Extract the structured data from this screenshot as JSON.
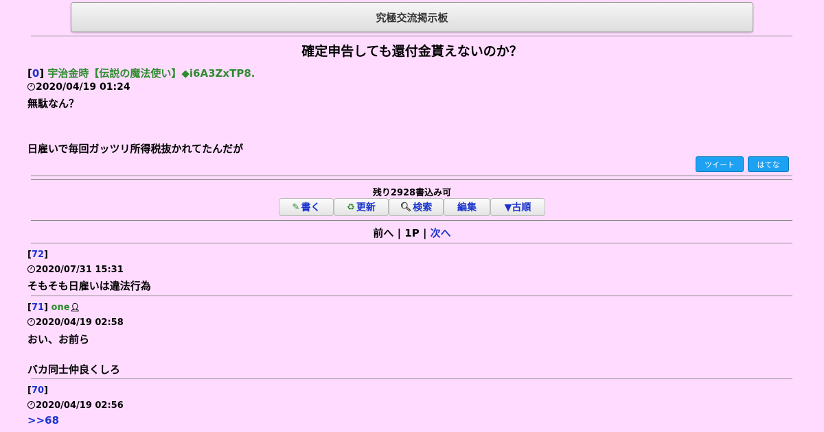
{
  "board": {
    "title": "究極交流掲示板"
  },
  "thread": {
    "title": "確定申告しても還付金貰えないのか？",
    "op": {
      "number": "0",
      "name": "宇治金時【伝説の魔法使い】◆i6A3ZxTP8.",
      "date": "2020/04/19 01:24",
      "lines": [
        "無駄なん？",
        "日雇いで毎回ガッツリ所得税抜かれてたんだが"
      ]
    }
  },
  "share": {
    "tweet_label": "ツイート",
    "hatena_label": "はてな"
  },
  "status": {
    "remaining": "残り2928書込み可"
  },
  "toolbar": {
    "write_label": "書く",
    "refresh_label": "更新",
    "search_label": "検索",
    "edit_label": "編集",
    "order_label": "▼古順"
  },
  "pager": {
    "prev": "前へ",
    "current": "1P",
    "next": "次へ",
    "sep": "|"
  },
  "posts": [
    {
      "number": "72",
      "name": "",
      "date": "2020/07/31 15:31",
      "lines": [
        "そもそも日雇いは違法行為"
      ]
    },
    {
      "number": "71",
      "name": "one",
      "date": "2020/04/19 02:58",
      "lines": [
        "おい、お前ら",
        "バカ同士仲良くしろ"
      ]
    },
    {
      "number": "70",
      "name": "",
      "date": "2020/04/19 02:56",
      "lines": [
        ">>68"
      ]
    }
  ],
  "colors": {
    "background": "#ffdcff",
    "link": "#1a33cc",
    "name": "#2e8b2e",
    "share_button": "#1da1f2"
  }
}
